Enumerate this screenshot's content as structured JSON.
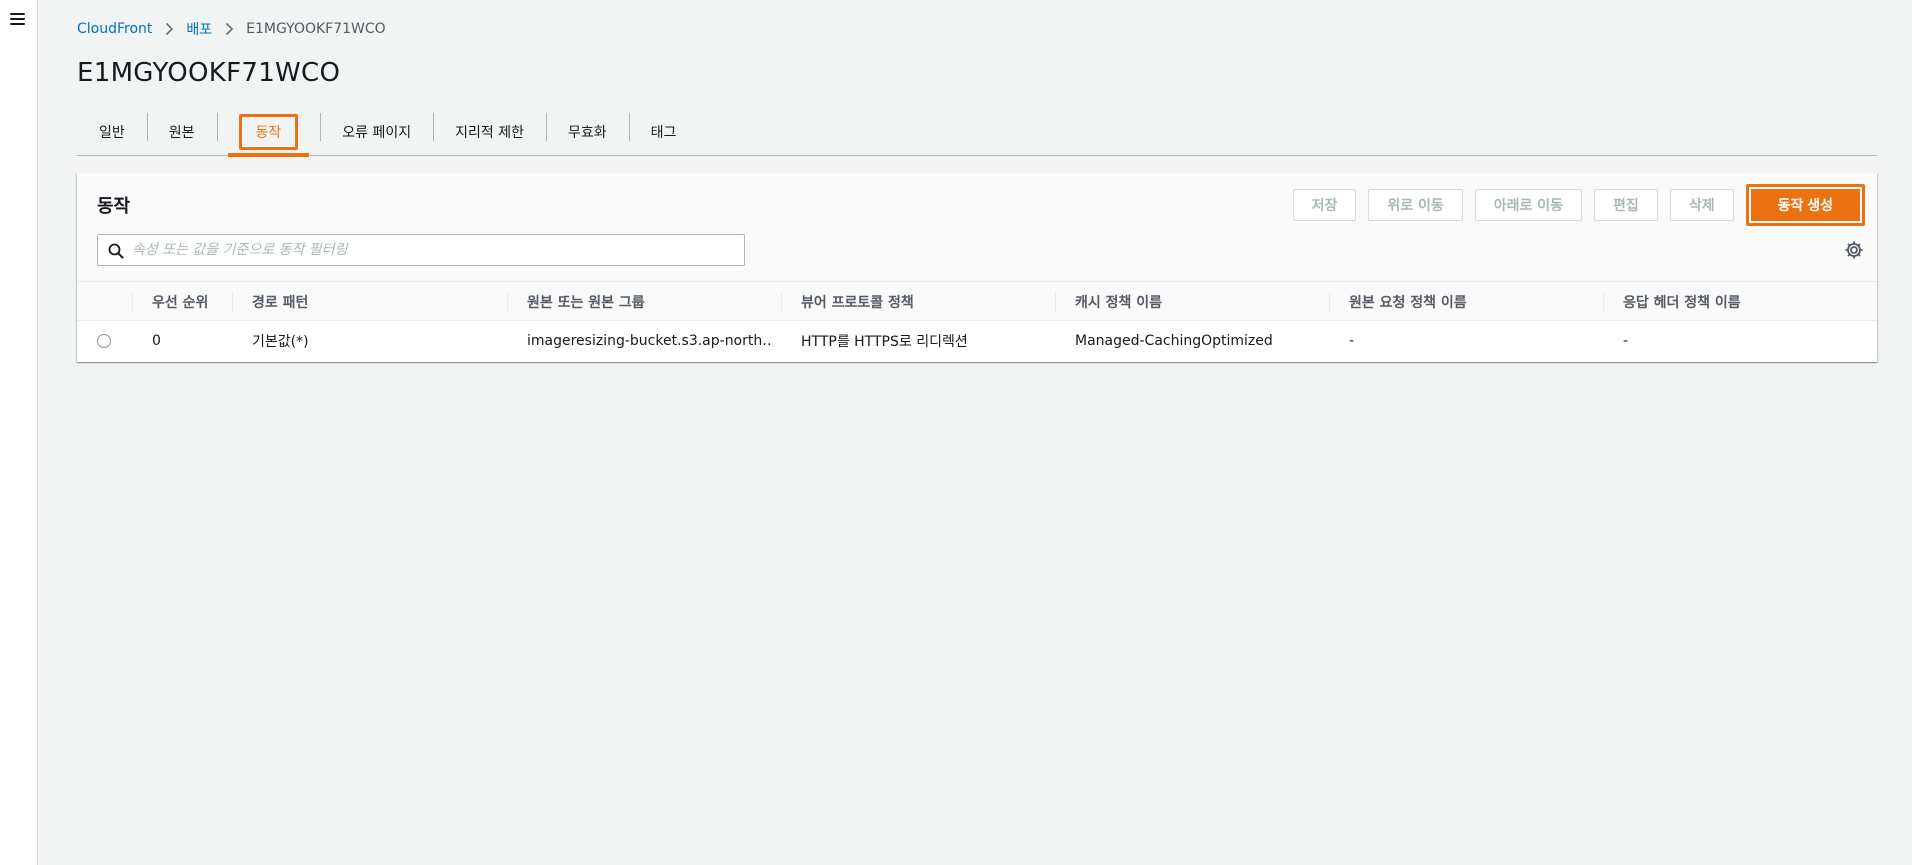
{
  "breadcrumb": {
    "items": [
      "CloudFront",
      "배포"
    ],
    "current": "E1MGYOOKF71WCO"
  },
  "page": {
    "title": "E1MGYOOKF71WCO"
  },
  "tabs": [
    {
      "label": "일반"
    },
    {
      "label": "원본"
    },
    {
      "label": "동작",
      "active": true
    },
    {
      "label": "오류 페이지"
    },
    {
      "label": "지리적 제한"
    },
    {
      "label": "무효화"
    },
    {
      "label": "태그"
    }
  ],
  "panel": {
    "title": "동작",
    "buttons": {
      "save": "저장",
      "move_up": "위로 이동",
      "move_down": "아래로 이동",
      "edit": "편집",
      "delete": "삭제",
      "create": "동작 생성"
    },
    "search": {
      "placeholder": "속성 또는 값을 기준으로 동작 필터링",
      "value": ""
    }
  },
  "table": {
    "columns": [
      "우선 순위",
      "경로 패턴",
      "원본 또는 원본 그룹",
      "뷰어 프로토콜 정책",
      "캐시 정책 이름",
      "원본 요청 정책 이름",
      "응답 헤더 정책 이름"
    ],
    "rows": [
      [
        "0",
        "기본값(*)",
        "imageresizing-bucket.s3.ap-north…",
        "HTTP를 HTTPS로 리디렉션",
        "Managed-CachingOptimized",
        "-",
        "-"
      ]
    ]
  },
  "colors": {
    "accent": "#ec7211",
    "link": "#0073bb",
    "background": "#f2f3f3"
  },
  "icons": [
    "menu-icon",
    "chevron-right-icon",
    "search-icon",
    "gear-icon"
  ]
}
